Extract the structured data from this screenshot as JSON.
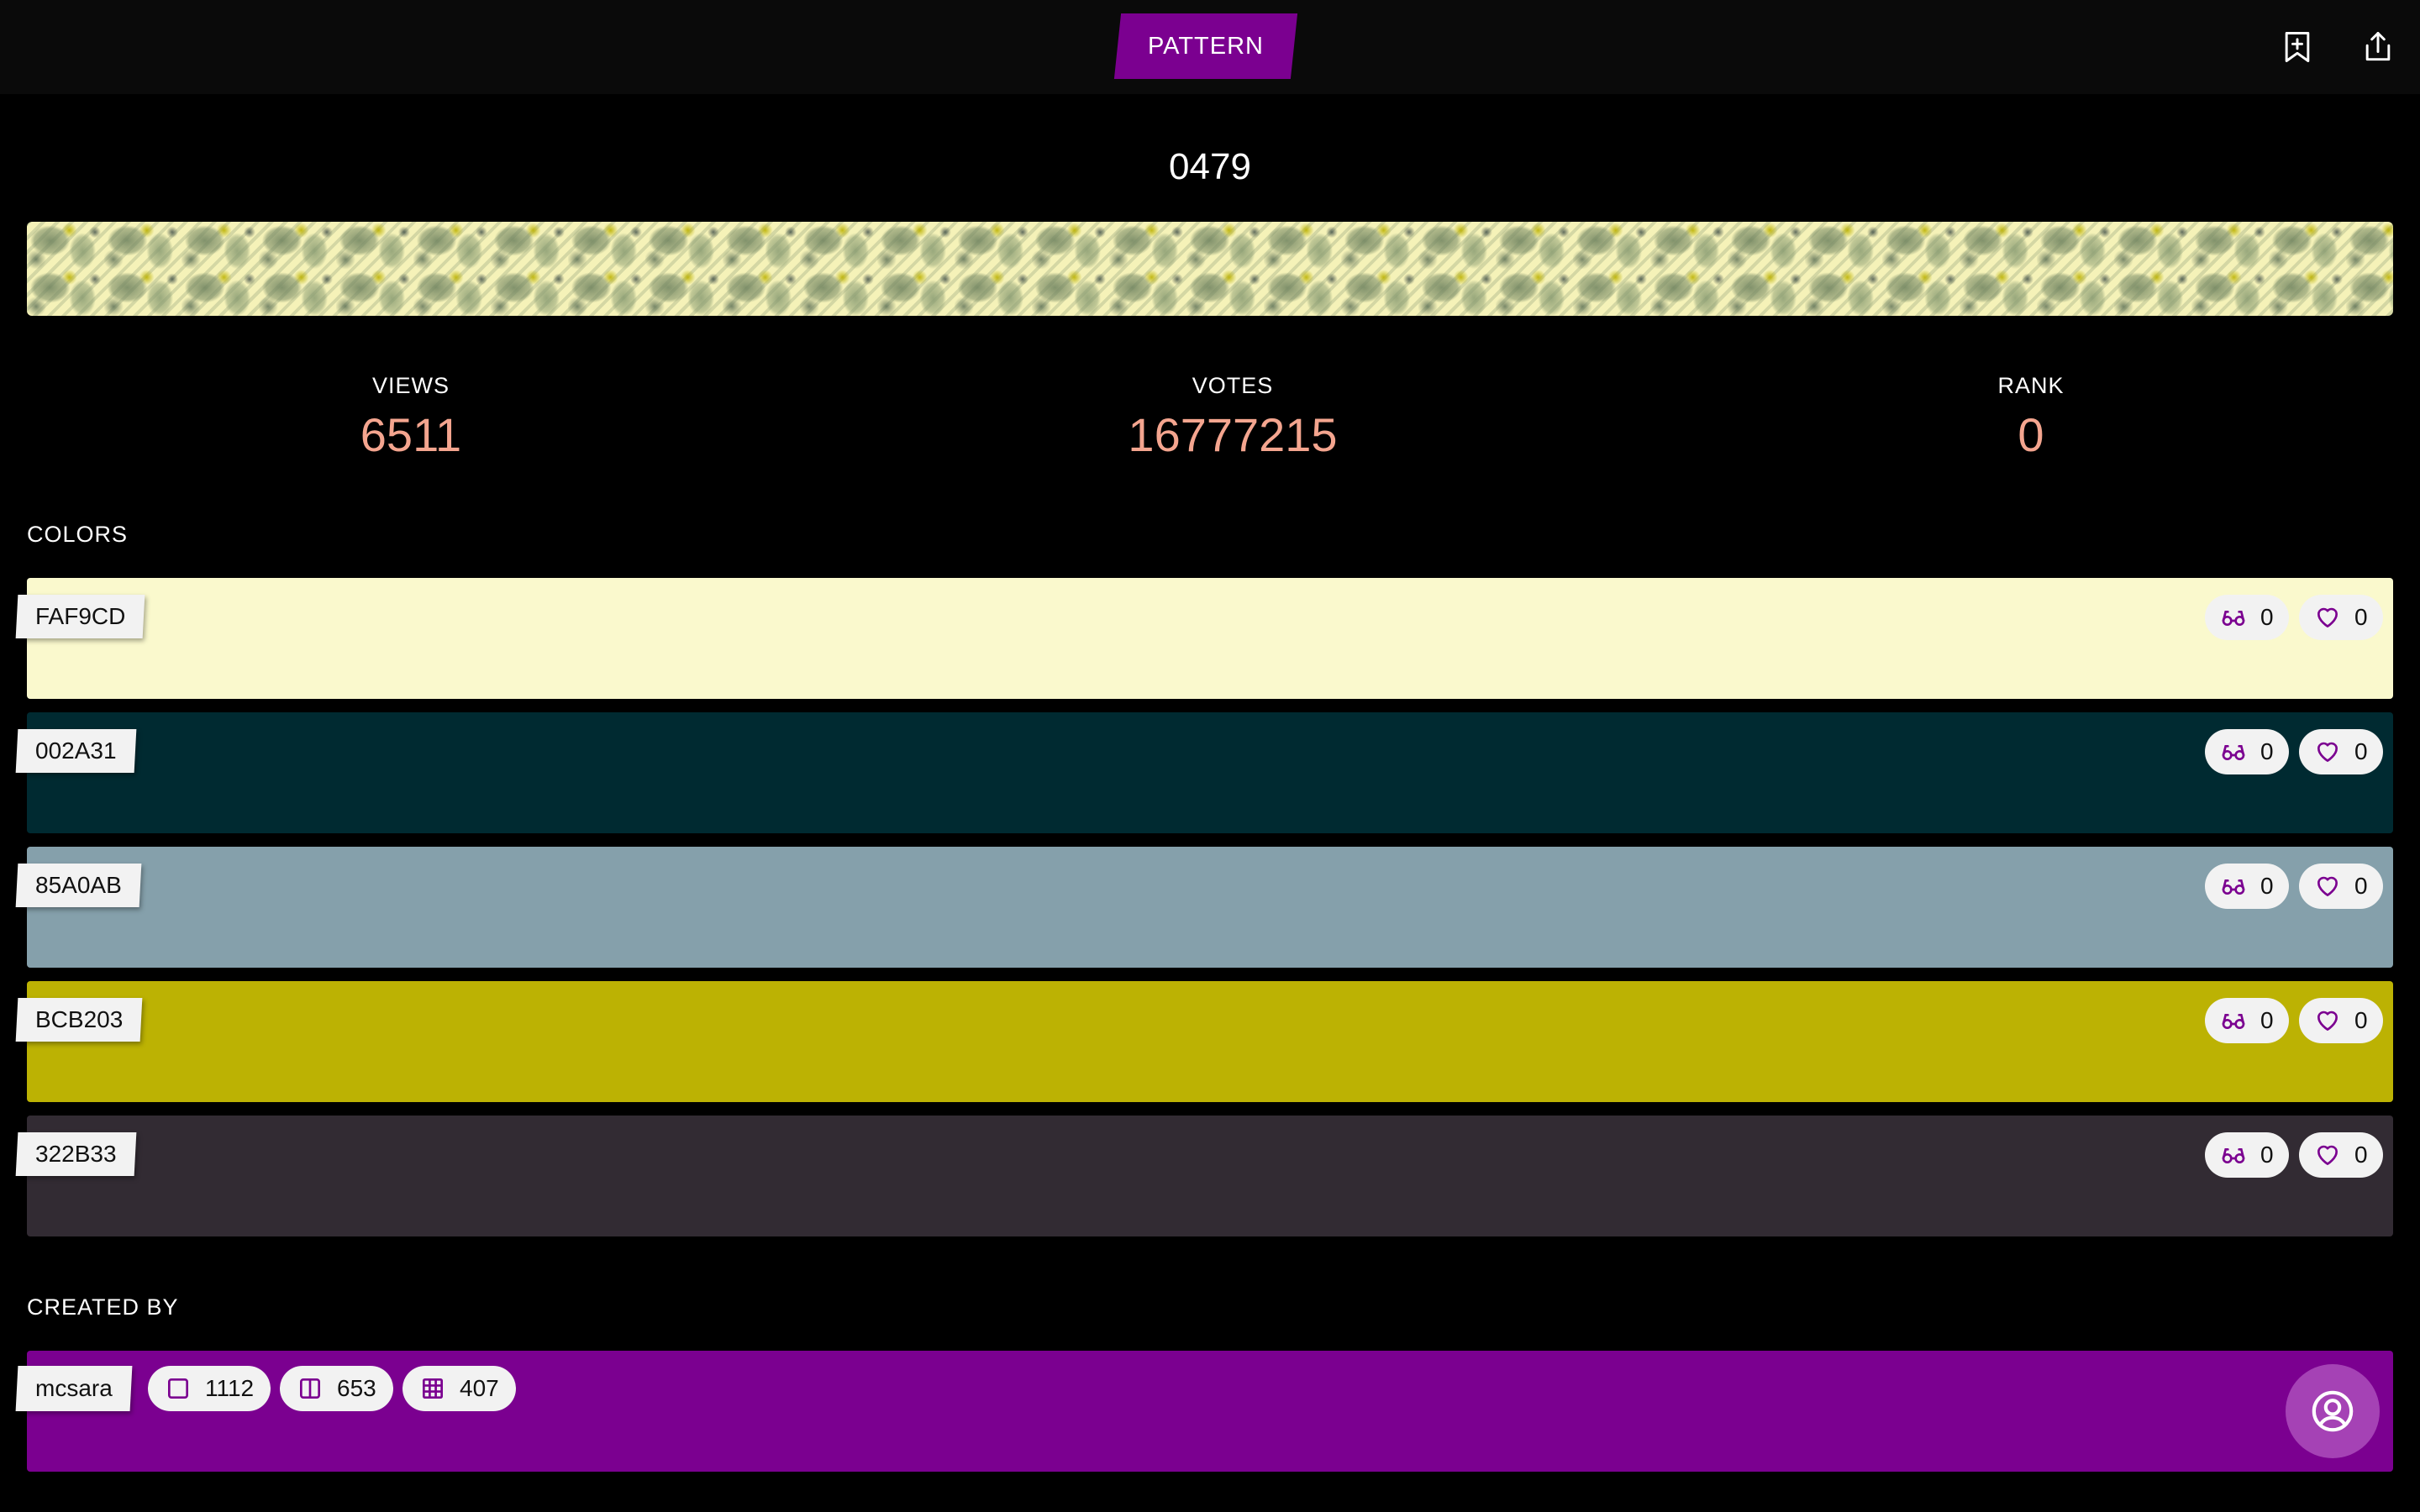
{
  "header": {
    "tab_label": "PATTERN",
    "icons": [
      "bookmark-add-icon",
      "share-icon"
    ]
  },
  "pattern": {
    "title": "0479"
  },
  "stats": {
    "views_label": "VIEWS",
    "views_value": "6511",
    "votes_label": "VOTES",
    "votes_value": "16777215",
    "rank_label": "RANK",
    "rank_value": "0"
  },
  "colors_section": {
    "label": "COLORS",
    "items": [
      {
        "hex": "FAF9CD",
        "color": "#FAF9CD",
        "views": "0",
        "likes": "0"
      },
      {
        "hex": "002A31",
        "color": "#002A31",
        "views": "0",
        "likes": "0"
      },
      {
        "hex": "85A0AB",
        "color": "#85A0AB",
        "views": "0",
        "likes": "0"
      },
      {
        "hex": "BCB203",
        "color": "#BCB203",
        "views": "0",
        "likes": "0"
      },
      {
        "hex": "322B33",
        "color": "#322B33",
        "views": "0",
        "likes": "0"
      }
    ]
  },
  "creator": {
    "label": "CREATED BY",
    "username": "mcsara",
    "colors_count": "1112",
    "palettes_count": "653",
    "patterns_count": "407",
    "background": "#7B0090"
  },
  "theme": {
    "accent": "#7B0090",
    "stat_value_color": "#F4A58F",
    "icon_color": "#7B0090"
  }
}
